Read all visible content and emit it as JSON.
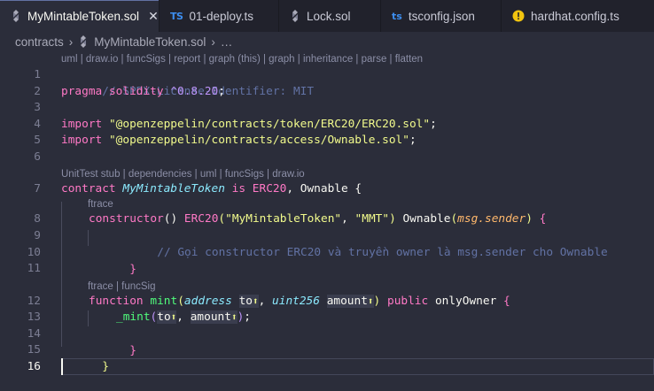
{
  "tabs": [
    {
      "label": "MyMintableToken.sol",
      "icon": "solidity-icon",
      "active": true,
      "close": "✕"
    },
    {
      "label": "01-deploy.ts",
      "icon": "typescript-icon",
      "icon_text": "TS"
    },
    {
      "label": "Lock.sol",
      "icon": "solidity-icon"
    },
    {
      "label": "tsconfig.json",
      "icon": "tsconfig-icon",
      "icon_text": "ts"
    },
    {
      "label": "hardhat.config.ts",
      "icon": "warning-icon"
    }
  ],
  "breadcrumb": {
    "folder": "contracts",
    "file": "MyMintableToken.sol",
    "tail": "…"
  },
  "codelens": {
    "header": "uml | draw.io | funcSigs | report | graph (this) | graph | inheritance | parse | flatten",
    "contract": "UnitTest stub | dependencies | uml | funcSigs | draw.io",
    "constructor": "ftrace",
    "mint": "ftrace | funcSig"
  },
  "line_numbers": [
    "1",
    "2",
    "3",
    "4",
    "5",
    "6",
    "7",
    "8",
    "9",
    "10",
    "11",
    "12",
    "13",
    "14",
    "15",
    "16"
  ],
  "code": {
    "l1": "// SPDX-License-Identifier: MIT",
    "l2_kw": "pragma",
    "l2_kw2": "solidity",
    "l2_ver": "^0.8.20",
    "l2_end": ";",
    "l4_kw": "import",
    "l4_str": "\"@openzeppelin/contracts/token/ERC20/ERC20.sol\"",
    "l4_end": ";",
    "l5_kw": "import",
    "l5_str": "\"@openzeppelin/contracts/access/Ownable.sol\"",
    "l5_end": ";",
    "l7_kw": "contract",
    "l7_name": "MyMintableToken",
    "l7_is": "is",
    "l7_base1": "ERC20",
    "l7_comma": ", ",
    "l7_base2": "Ownable",
    "l7_brace": " {",
    "l8_kw": "constructor",
    "l8_paren": "()",
    "l8_erc": "ERC20",
    "l8_open": "(",
    "l8_str1": "\"MyMintableToken\"",
    "l8_comma": ", ",
    "l8_str2": "\"MMT\"",
    "l8_close": ")",
    "l8_own": "Ownable",
    "l8_open2": "(",
    "l8_msg": "msg.sender",
    "l8_close2": ")",
    "l8_brace": " {",
    "l9": "// Gọi constructor ERC20 và truyền owner là msg.sender cho Ownable",
    "l10": "}",
    "l12_kw": "function",
    "l12_fn": "mint",
    "l12_open": "(",
    "l12_t1": "address",
    "l12_p1": "to",
    "l12_comma": ", ",
    "l12_t2": "uint256",
    "l12_p2": "amount",
    "l12_close": ")",
    "l12_pub": "public",
    "l12_mod": "onlyOwner",
    "l12_brace": " {",
    "l13_fn": "_mint",
    "l13_open": "(",
    "l13_a1": "to",
    "l13_comma": ", ",
    "l13_a2": "amount",
    "l13_close": ")",
    "l13_end": ";",
    "l14": "}",
    "l15": "}",
    "param_marker": "⬆"
  },
  "colors": {
    "background": "#2b2d3a",
    "tabbar": "#21222c",
    "comment": "#6272a4",
    "keyword": "#ff79c6",
    "string": "#f1fa8c",
    "function": "#50fa7b",
    "type": "#8be9fd",
    "variable": "#ffb86c"
  }
}
